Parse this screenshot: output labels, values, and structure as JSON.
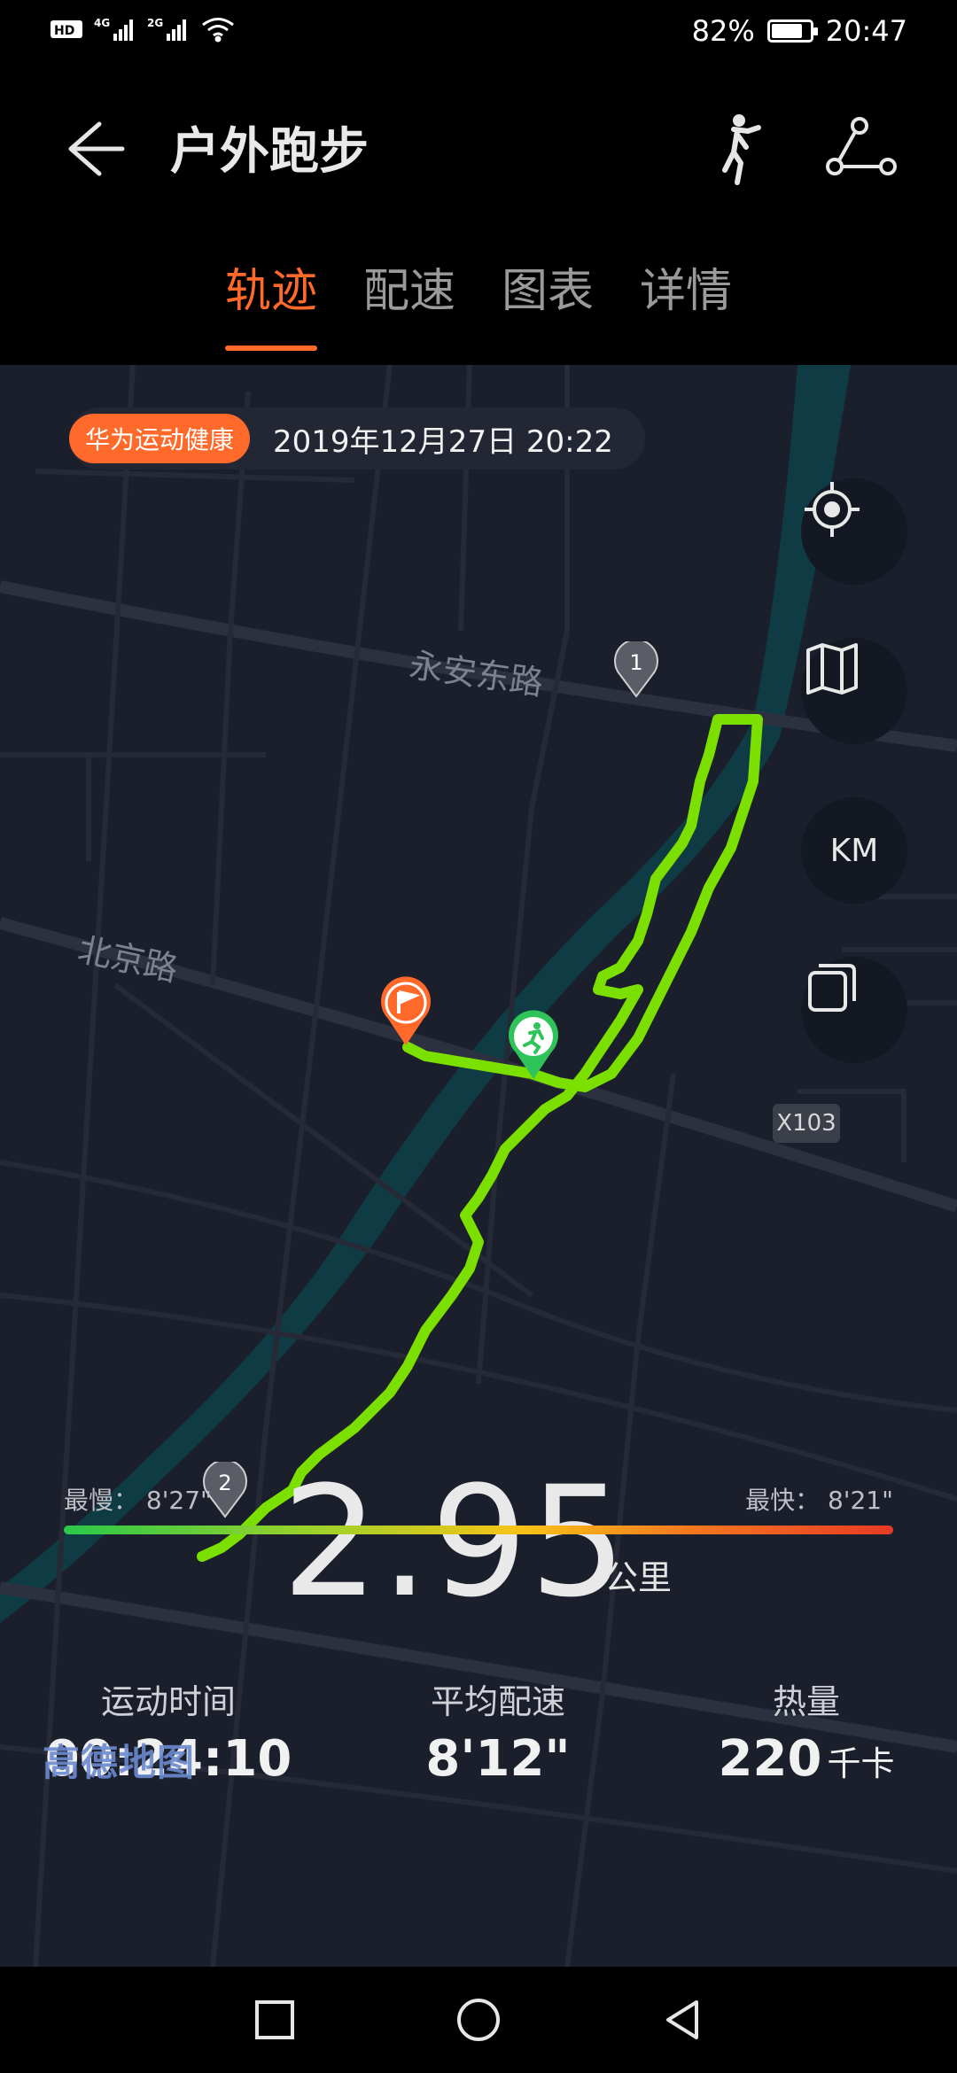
{
  "status_bar": {
    "left_icons": [
      "hd-icon",
      "4g-signal-icon",
      "2g-signal-icon",
      "wifi-icon"
    ],
    "net1": "4G",
    "net2": "2G",
    "battery_percent": "82%",
    "battery_level": 0.82,
    "time": "20:47"
  },
  "header": {
    "title": "户外跑步",
    "back_icon": "back-arrow-icon",
    "right_icons": [
      "running-figure-icon",
      "route-share-icon"
    ]
  },
  "tabs": [
    {
      "label": "轨迹",
      "active": true
    },
    {
      "label": "配速",
      "active": false
    },
    {
      "label": "图表",
      "active": false
    },
    {
      "label": "详情",
      "active": false
    }
  ],
  "map": {
    "brand_badge": "华为运动健康",
    "date": "2019年12月27日 20:22",
    "roads": {
      "road1": "永安东路",
      "road2": "北京路",
      "highway": "X103"
    },
    "buttons": [
      {
        "name": "locate-icon"
      },
      {
        "name": "map-layer-icon"
      },
      {
        "name": "km-button",
        "label": "KM"
      },
      {
        "name": "overlay-icon"
      }
    ],
    "markers": {
      "km1": "1",
      "km2": "2"
    },
    "track_color": "#7be000",
    "water_color": "#0f3b44"
  },
  "summary": {
    "distance": "2.95",
    "distance_unit": "公里"
  },
  "stats": {
    "duration_label": "运动时间",
    "duration": "00:24:10",
    "pace_label": "平均配速",
    "pace": "8'12\"",
    "calories_label": "热量",
    "calories": "220",
    "calories_unit": "千卡"
  },
  "map_logo": "高德地图",
  "pace_range": {
    "slowest": "最慢：  8'27\"",
    "fastest": "最快：  8'21\""
  },
  "colors": {
    "accent": "#ff6a2b",
    "map_bg": "#1a1f2b",
    "track": "#7be000"
  }
}
